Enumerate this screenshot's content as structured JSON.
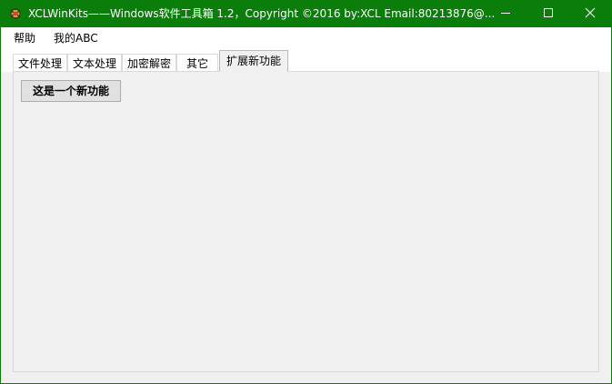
{
  "window": {
    "title": "XCLWinKits——Windows软件工具箱    1.2，Copyright ©2016 by:XCL Email:80213876@...",
    "accent_color": "#0b7d0b",
    "icon": "app-logo-icon",
    "controls": {
      "minimize_icon": "minimize-icon",
      "maximize_icon": "maximize-icon",
      "close_icon": "close-icon"
    }
  },
  "menu": {
    "items": [
      {
        "label": "帮助"
      },
      {
        "label": "我的ABC"
      }
    ]
  },
  "tabs": [
    {
      "label": "文件处理",
      "selected": false
    },
    {
      "label": "文本处理",
      "selected": false
    },
    {
      "label": "加密解密",
      "selected": false
    },
    {
      "label": "其它",
      "selected": false
    },
    {
      "label": "扩展新功能",
      "selected": true
    }
  ],
  "panel": {
    "button_label": "这是一个新功能"
  }
}
